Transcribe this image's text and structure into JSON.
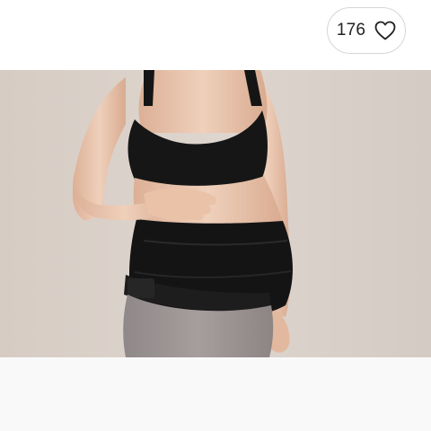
{
  "like_button": {
    "count": "176",
    "icon": "heart-outline-icon"
  },
  "product_image": {
    "description_colors": {
      "background": "#d8cfc8",
      "garment": "#151515",
      "skin": "#e8c3a8",
      "leggings": "#9a9292"
    }
  }
}
